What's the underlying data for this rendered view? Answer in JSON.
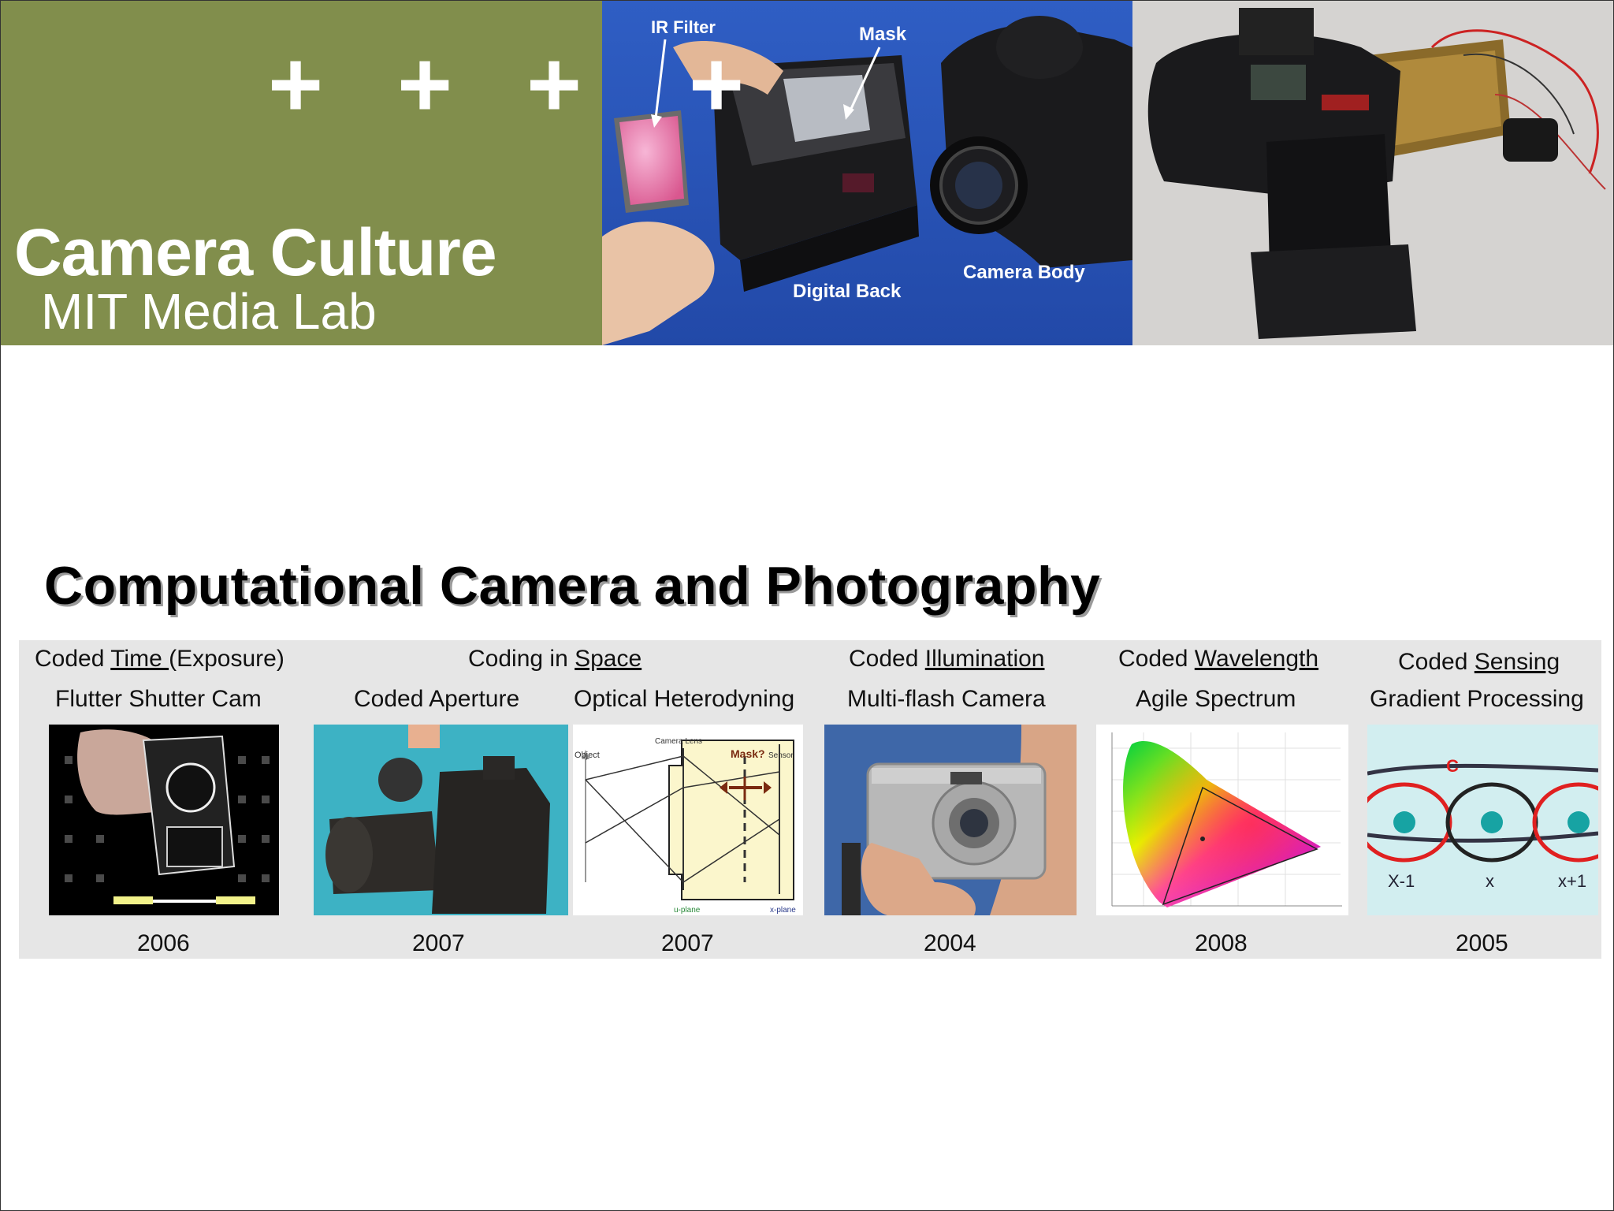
{
  "header": {
    "plus_marks": [
      "+",
      "+",
      "+",
      "+"
    ],
    "brand": {
      "line1": "Camera Culture",
      "line2": "MIT Media Lab"
    },
    "photo_labels": {
      "ir_filter": "IR Filter",
      "mask": "Mask",
      "digital_back": "Digital Back",
      "camera_body": "Camera Body"
    }
  },
  "title": "Computational Camera and Photography",
  "categories": [
    {
      "prefix": "Coded ",
      "key": "Time ",
      "suffix": "(Exposure)"
    },
    {
      "prefix": "Coding in ",
      "key": "Space",
      "suffix": ""
    },
    {
      "prefix": "Coded ",
      "key": "Illumination",
      "suffix": ""
    },
    {
      "prefix": "Coded ",
      "key": "Wavelength",
      "suffix": ""
    },
    {
      "prefix": "Coded ",
      "key": "Sensing",
      "suffix": ""
    }
  ],
  "techniques": [
    {
      "name": "Flutter Shutter Cam",
      "year": "2006"
    },
    {
      "name": "Coded Aperture",
      "year": "2007"
    },
    {
      "name": "Optical Heterodyning",
      "year": "2007"
    },
    {
      "name": "Multi-flash Camera",
      "year": "2004"
    },
    {
      "name": "Agile Spectrum",
      "year": "2008"
    },
    {
      "name": "Gradient Processing",
      "year": "2005"
    }
  ],
  "diagram_labels": {
    "heterodyne": {
      "object": "Object",
      "lens": "Camera Lens",
      "mask": "Mask?",
      "sensor": "Sensor",
      "uplane": "u-plane",
      "xplane": "x-plane"
    },
    "gradient": {
      "c": "C",
      "left": "X-1",
      "mid": "x",
      "right": "x+1"
    }
  },
  "colors": {
    "banner_olive": "#818e4c",
    "panel_gray": "#e6e6e6",
    "blue_backdrop": "#2953b8"
  }
}
